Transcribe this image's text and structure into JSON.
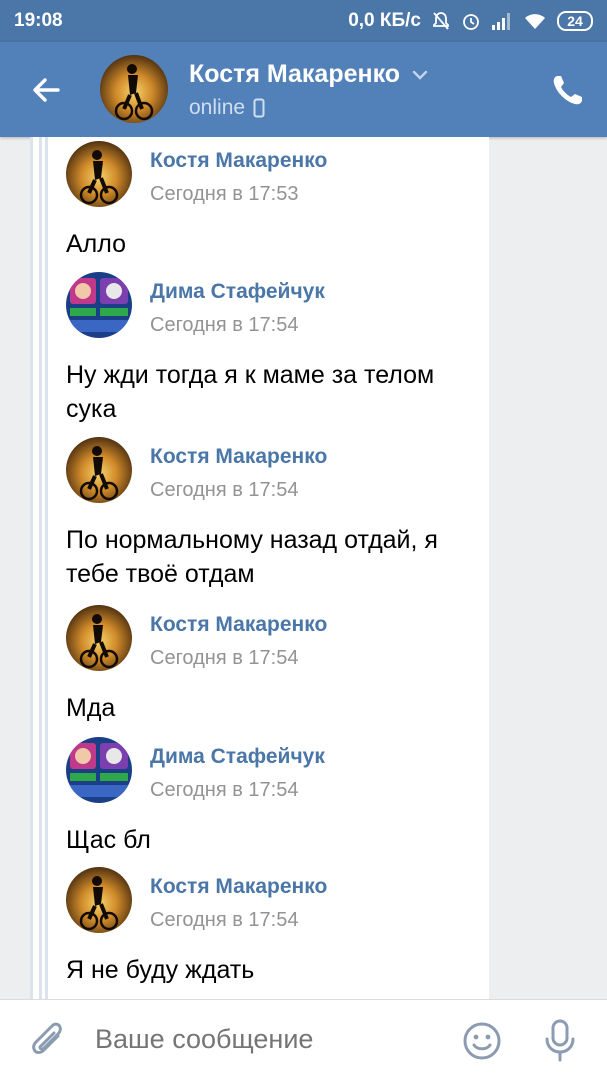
{
  "status_bar": {
    "time": "19:08",
    "net_speed": "0,0 КБ/с",
    "battery": "24",
    "icons": [
      "mute-bell-icon",
      "alarm-icon",
      "signal-icon",
      "wifi-icon",
      "battery-icon"
    ]
  },
  "header": {
    "name": "Костя Макаренко",
    "status": "online",
    "icons": [
      "back-arrow-icon",
      "chevron-down-icon",
      "mobile-icon",
      "phone-icon"
    ]
  },
  "messages": [
    {
      "sender": "Костя Макаренко",
      "time": "Сегодня в 17:53",
      "text": "Алло",
      "avatar": "kostya"
    },
    {
      "sender": "Дима Стафейчук",
      "time": "Сегодня в 17:54",
      "text": "Ну жди тогда я к маме за телом сука",
      "avatar": "dima"
    },
    {
      "sender": "Костя Макаренко",
      "time": "Сегодня в 17:54",
      "text": "По нормальному назад отдай, я тебе твоё отдам",
      "avatar": "kostya"
    },
    {
      "sender": "Костя Макаренко",
      "time": "Сегодня в 17:54",
      "text": "Мда",
      "avatar": "kostya"
    },
    {
      "sender": "Дима Стафейчук",
      "time": "Сегодня в 17:54",
      "text": "Щас бл",
      "avatar": "dima"
    },
    {
      "sender": "Костя Макаренко",
      "time": "Сегодня в 17:54",
      "text": "Я не буду ждать",
      "avatar": "kostya"
    }
  ],
  "composer": {
    "placeholder": "Ваше сообщение",
    "icons": [
      "paperclip-icon",
      "smile-icon",
      "microphone-icon"
    ]
  },
  "colors": {
    "header_bg": "#5181b8",
    "statusbar_bg": "#4a76a8",
    "sender_name": "#4a76a8",
    "chat_bg": "#edeef0"
  }
}
